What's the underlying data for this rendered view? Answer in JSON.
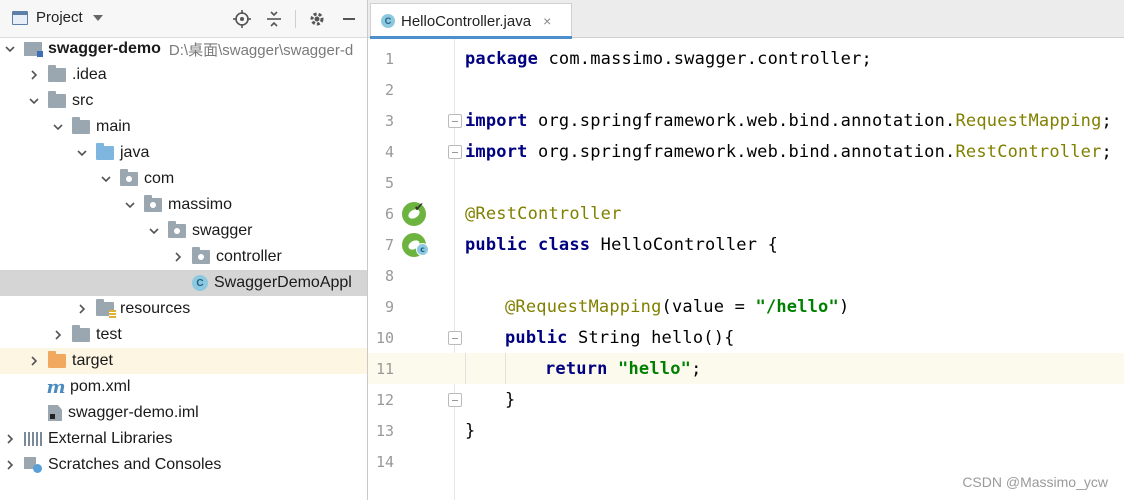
{
  "project_panel": {
    "title": "Project",
    "tools": [
      "locate-icon",
      "collapse-icon",
      "gear-icon",
      "minimize-icon"
    ],
    "tree": [
      {
        "label": "swagger-demo",
        "path": "D:\\桌面\\swagger\\swagger-d",
        "icon": "module-icon",
        "expanded": true
      },
      {
        "label": ".idea",
        "icon": "folder-icon",
        "expanded": false
      },
      {
        "label": "src",
        "icon": "folder-icon",
        "expanded": true
      },
      {
        "label": "main",
        "icon": "folder-icon",
        "expanded": true
      },
      {
        "label": "java",
        "icon": "source-folder-icon",
        "expanded": true
      },
      {
        "label": "com",
        "icon": "package-icon",
        "expanded": true
      },
      {
        "label": "massimo",
        "icon": "package-icon",
        "expanded": true
      },
      {
        "label": "swagger",
        "icon": "package-icon",
        "expanded": true
      },
      {
        "label": "controller",
        "icon": "package-icon",
        "expanded": false
      },
      {
        "label": "SwaggerDemoAppl",
        "icon": "spring-class-icon",
        "selected": true
      },
      {
        "label": "resources",
        "icon": "resources-folder-icon",
        "expanded": false
      },
      {
        "label": "test",
        "icon": "folder-icon",
        "expanded": false
      },
      {
        "label": "target",
        "icon": "excluded-folder-icon",
        "expanded": false
      },
      {
        "label": "pom.xml",
        "icon": "maven-icon"
      },
      {
        "label": "swagger-demo.iml",
        "icon": "iml-file-icon"
      },
      {
        "label": "External Libraries",
        "icon": "libraries-icon",
        "expanded": false
      },
      {
        "label": "Scratches and Consoles",
        "icon": "scratches-icon",
        "expanded": false
      }
    ]
  },
  "editor": {
    "tab": {
      "label": "HelloController.java",
      "close": "×"
    },
    "lines": [
      {
        "num": "1"
      },
      {
        "num": "2"
      },
      {
        "num": "3"
      },
      {
        "num": "4"
      },
      {
        "num": "5"
      },
      {
        "num": "6"
      },
      {
        "num": "7"
      },
      {
        "num": "8"
      },
      {
        "num": "9"
      },
      {
        "num": "10"
      },
      {
        "num": "11"
      },
      {
        "num": "12"
      },
      {
        "num": "13"
      },
      {
        "num": "14"
      }
    ],
    "code": {
      "l1_kw": "package",
      "l1_rest": " com.massimo.swagger.controller;",
      "l3_kw": "import",
      "l3_rest": " org.springframework.web.bind.annotation.",
      "l3_cls": "RequestMapping",
      "l3_end": ";",
      "l4_kw": "import",
      "l4_rest": " org.springframework.web.bind.annotation.",
      "l4_cls": "RestController",
      "l4_end": ";",
      "l6_anno": "@RestController",
      "l7_kw1": "public",
      "l7_kw2": " class",
      "l7_rest": " HelloController {",
      "l9_anno": "@RequestMapping",
      "l9_mid": "(value = ",
      "l9_str": "\"/hello\"",
      "l9_end": ")",
      "l10_kw": "public",
      "l10_rest": " String hello(){",
      "l11_kw": "return",
      "l11_sp": " ",
      "l11_str": "\"hello\"",
      "l11_end": ";",
      "l12": "}",
      "l13": "}"
    },
    "current_line": "11"
  },
  "watermark": "CSDN @Massimo_ycw",
  "colors": {
    "keyword": "#000080",
    "annotation": "#808000",
    "string": "#008000",
    "tab_accent": "#4d8fcc",
    "selection": "#d5d5d5"
  }
}
